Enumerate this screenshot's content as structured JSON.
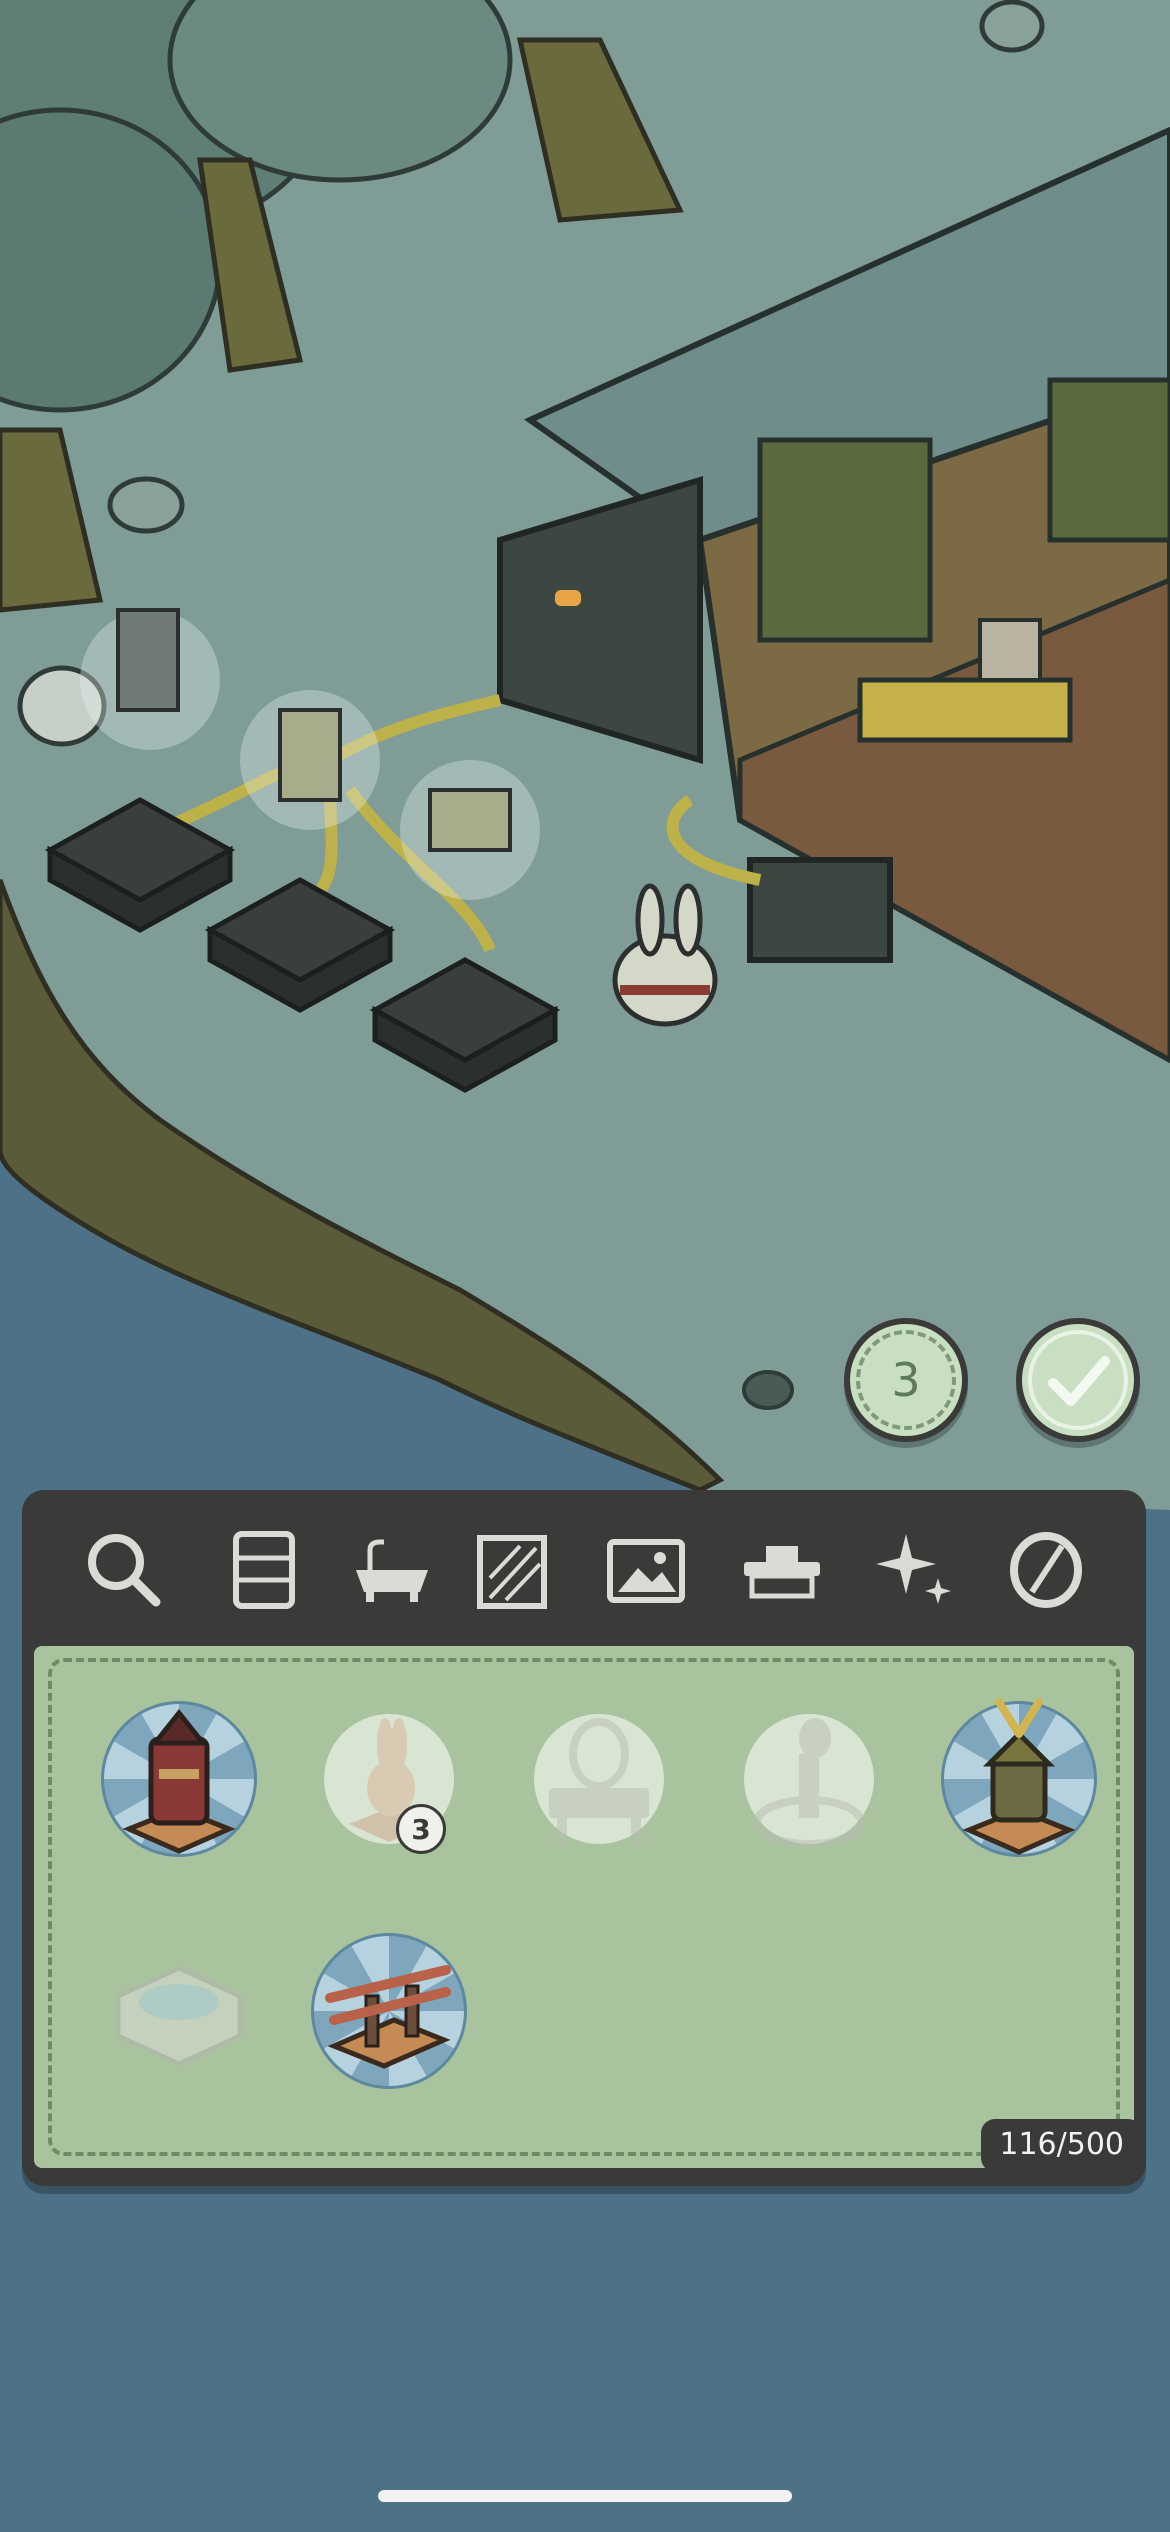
{
  "map": {
    "cost_badge": "3",
    "confirm_icon": "check-icon"
  },
  "toolbar": {
    "tools": [
      "search-icon",
      "shelf-icon",
      "bathtub-icon",
      "wallpaper-icon",
      "picture-icon",
      "workbench-icon",
      "sparkle-icon",
      "flooring-icon"
    ]
  },
  "inventory": {
    "items": [
      {
        "name": "samurai-armor-statue",
        "owned": true
      },
      {
        "name": "rabbit-statue",
        "owned": false,
        "quantity": "3"
      },
      {
        "name": "vanity-mirror",
        "owned": false
      },
      {
        "name": "rabbit-fountain",
        "owned": false
      },
      {
        "name": "kabuto-statue",
        "owned": true
      },
      {
        "name": "stone-basin",
        "owned": false
      },
      {
        "name": "katana-rack",
        "owned": true
      }
    ],
    "capacity": "116/500"
  },
  "colors": {
    "water": "#4d7287",
    "grass": "#7f9c97",
    "panel": "#3a3b38",
    "grid": "#a8c39d",
    "accent_green": "#c9dfc2"
  }
}
